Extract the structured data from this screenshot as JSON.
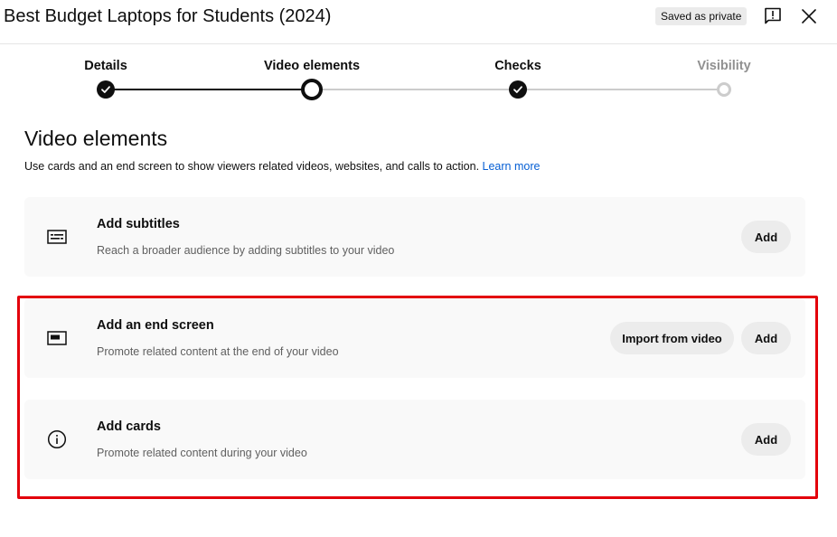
{
  "header": {
    "title": "Best Budget Laptops for Students (2024)",
    "saved_badge": "Saved as private",
    "feedback_icon": "feedback-icon",
    "close_icon": "close-icon"
  },
  "stepper": {
    "steps": [
      {
        "label": "Details",
        "state": "done"
      },
      {
        "label": "Video elements",
        "state": "current"
      },
      {
        "label": "Checks",
        "state": "done"
      },
      {
        "label": "Visibility",
        "state": "disabled"
      }
    ]
  },
  "main": {
    "title": "Video elements",
    "description": "Use cards and an end screen to show viewers related videos, websites, and calls to action.",
    "learn_more": "Learn more",
    "cards": [
      {
        "title": "Add subtitles",
        "subtitle": "Reach a broader audience by adding subtitles to your video",
        "icon": "subtitles-icon",
        "add_label": "Add"
      },
      {
        "title": "Add an end screen",
        "subtitle": "Promote related content at the end of your video",
        "icon": "end-screen-icon",
        "import_label": "Import from video",
        "add_label": "Add"
      },
      {
        "title": "Add cards",
        "subtitle": "Promote related content during your video",
        "icon": "info-icon",
        "add_label": "Add"
      }
    ]
  },
  "colors": {
    "highlight": "#e3000b",
    "link": "#065fd4",
    "card_bg": "#f9f9f9"
  }
}
